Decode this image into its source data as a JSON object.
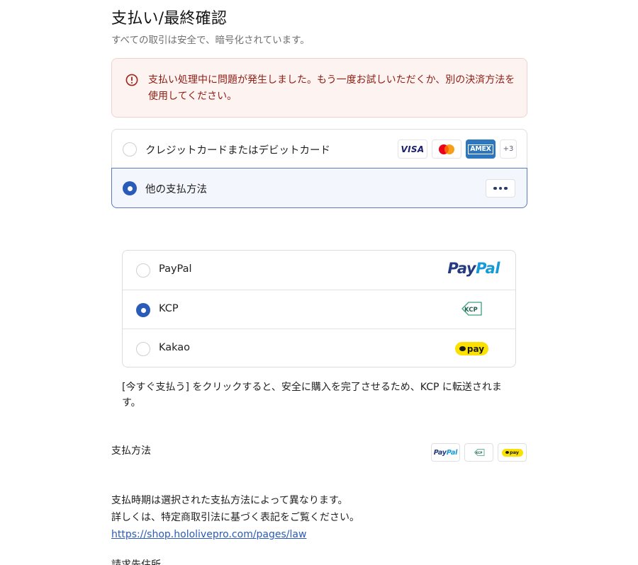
{
  "header": {
    "title": "支払い/最終確認",
    "subtitle": "すべての取引は安全で、暗号化されています。"
  },
  "error": {
    "icon": "alert-circle-icon",
    "message": "支払い処理中に問題が発生しました。もう一度お試しいただくか、別の決済方法を使用してください。",
    "colors": {
      "background": "#fdf3f1",
      "text": "#8f1d12"
    }
  },
  "payment_methods": {
    "card": {
      "label": "クレジットカードまたはデビットカード",
      "selected": false,
      "brands": [
        "VISA",
        "mastercard",
        "AMEX"
      ],
      "more_count": "+3"
    },
    "other": {
      "label": "他の支払方法",
      "selected": true,
      "more_icon": "more-dots-icon"
    }
  },
  "sub_methods": [
    {
      "label": "PayPal",
      "selected": false,
      "logo": "paypal-logo"
    },
    {
      "label": "KCP",
      "selected": true,
      "logo": "kcp-logo"
    },
    {
      "label": "Kakao",
      "selected": false,
      "logo": "kakaopay-logo",
      "logo_text": "pay"
    }
  ],
  "paypal_logo": {
    "part1": "Pay",
    "part2": "Pal"
  },
  "redirect_note": "[今すぐ支払う] をクリックすると、安全に購入を完了させるため、KCP に転送されます。",
  "payment_summary": {
    "label": "支払方法",
    "badges": [
      "paypal-logo",
      "kcp-logo",
      "kakaopay-logo"
    ]
  },
  "info": {
    "line1": "支払時期は選択された支払方法によって異なります。",
    "line2": "詳しくは、特定商取引法に基づく表記をご覧ください。",
    "link": "https://shop.hololivepro.com/pages/law"
  },
  "cut_off_text": "請求先住所",
  "colors": {
    "accent": "#2a5bb8",
    "selected_row_bg": "#f4f6fd",
    "selected_row_border": "#5a7cbf",
    "paypal_dark": "#253b80",
    "paypal_light": "#179bd7",
    "kakao_yellow": "#fae100",
    "amex_blue": "#2e77bc"
  }
}
